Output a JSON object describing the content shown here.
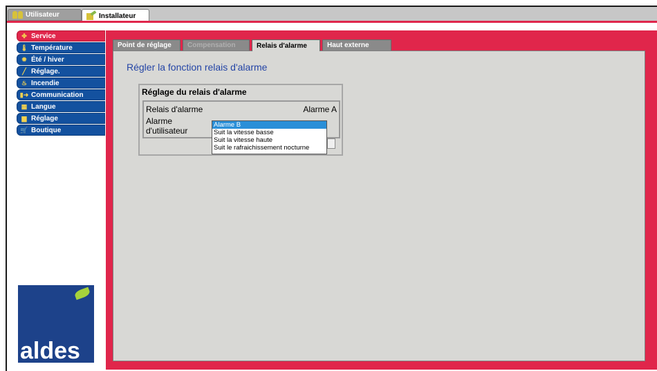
{
  "top_tabs": [
    {
      "label": "Utilisateur",
      "icon": "users-icon",
      "active": false
    },
    {
      "label": "Installateur",
      "icon": "installer-icon",
      "active": true
    }
  ],
  "sidebar": {
    "items": [
      {
        "label": "Service",
        "icon": "service-icon",
        "active": true
      },
      {
        "label": "Température",
        "icon": "thermometer-icon",
        "active": false
      },
      {
        "label": "Été / hiver",
        "icon": "sun-icon",
        "active": false
      },
      {
        "label": "Réglage.",
        "icon": "wrench-icon",
        "active": false
      },
      {
        "label": "Incendie",
        "icon": "fire-icon",
        "active": false
      },
      {
        "label": "Communication",
        "icon": "communication-icon",
        "active": false
      },
      {
        "label": "Langue",
        "icon": "language-icon",
        "active": false
      },
      {
        "label": "Réglage",
        "icon": "settings-icon",
        "active": false
      },
      {
        "label": "Boutique",
        "icon": "cart-icon",
        "active": false
      }
    ],
    "logo_text": "aldes"
  },
  "panel_tabs": [
    {
      "label": "Point de réglage",
      "state": "normal"
    },
    {
      "label": "Compensation",
      "state": "disabled"
    },
    {
      "label": "Relais d'alarme",
      "state": "active"
    },
    {
      "label": "Haut externe",
      "state": "normal"
    }
  ],
  "main": {
    "heading": "Régler la fonction relais d'alarme",
    "group_title": "Réglage du relais d'alarme",
    "relais_label": "Relais d'alarme",
    "relais_value": "Alarme A",
    "user_label_line1": "Alarme",
    "user_label_line2": "d'utilisateur",
    "dropdown_options": [
      "Alarme B",
      "Suit la vitesse basse",
      "Suit la vitesse haute",
      "Suit le rafraichissement nocturne"
    ],
    "dropdown_selected": "Alarme B"
  },
  "colors": {
    "accent_red": "#e0264b",
    "nav_blue": "#13519f",
    "panel_gray": "#d8d8d5",
    "heading_blue": "#2445a6",
    "selection_blue": "#2a8fd8"
  }
}
